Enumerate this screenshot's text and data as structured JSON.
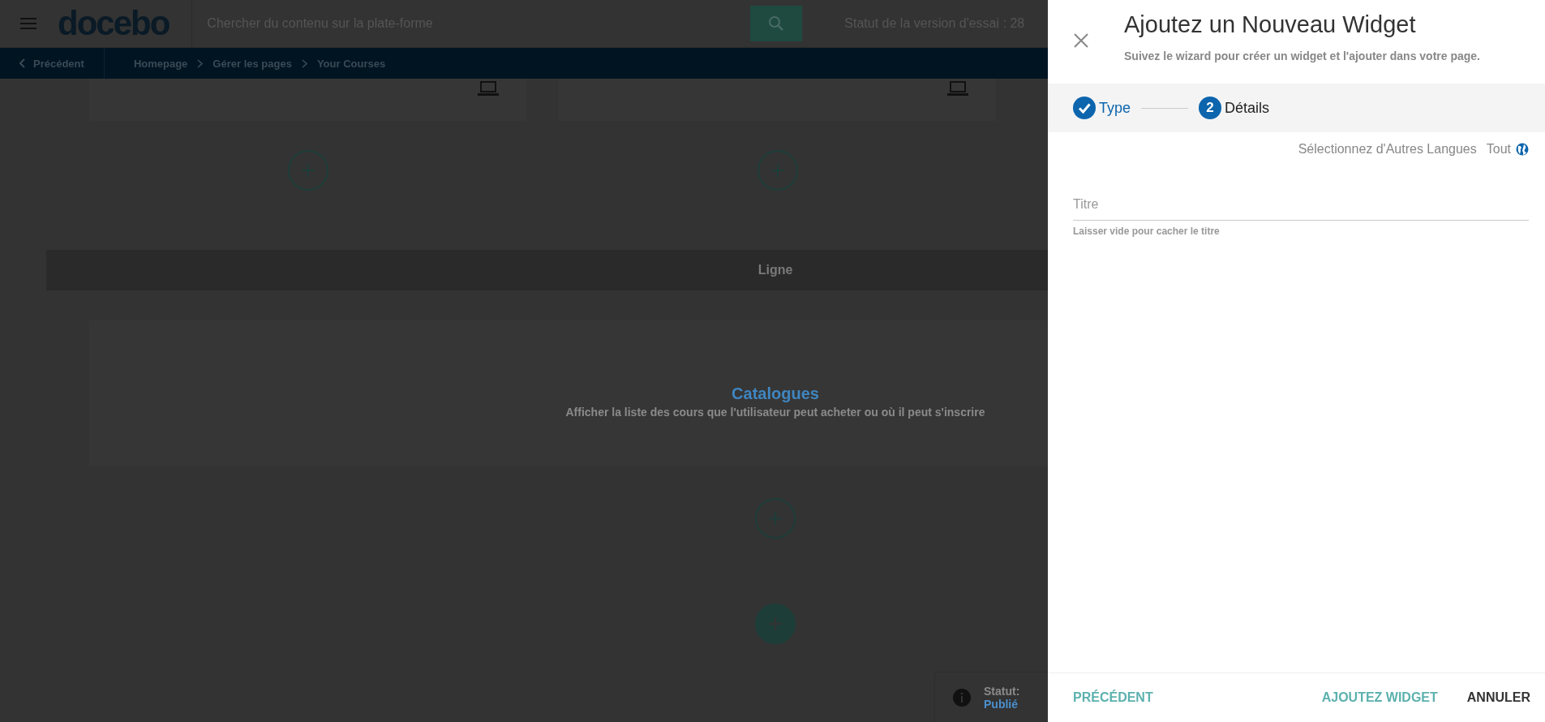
{
  "header": {
    "logo": "docebo",
    "search": {
      "placeholder": "Chercher du contenu sur la plate-forme"
    },
    "trial_status": "Statut de la version d'essai : 28"
  },
  "breadcrumb": {
    "back": "Précédent",
    "items": [
      "Homepage",
      "Gérer les pages",
      "Your Courses"
    ]
  },
  "row_label": "Ligne",
  "catalog_widget": {
    "title": "Catalogues",
    "description": "Afficher la liste des cours que l'utilisateur peut acheter ou où il peut s'inscrire"
  },
  "page_status": {
    "label": "Statut:",
    "value": "Publié"
  },
  "panel": {
    "title": "Ajoutez un Nouveau Widget",
    "subtitle": "Suivez le wizard pour créer un widget et l'ajouter dans votre page.",
    "steps": [
      {
        "label": "Type",
        "done": true
      },
      {
        "label": "Détails",
        "number": "2",
        "done": false
      }
    ],
    "language_selector": {
      "label": "Sélectionnez d'Autres Langues",
      "value": "Tout"
    },
    "fields": [
      {
        "placeholder": "Titre",
        "hint": "Laisser vide pour cacher le titre"
      }
    ],
    "footer": {
      "back": "PRÉCÉDENT",
      "add": "AJOUTEZ WIDGET",
      "cancel": "ANNULER"
    }
  }
}
